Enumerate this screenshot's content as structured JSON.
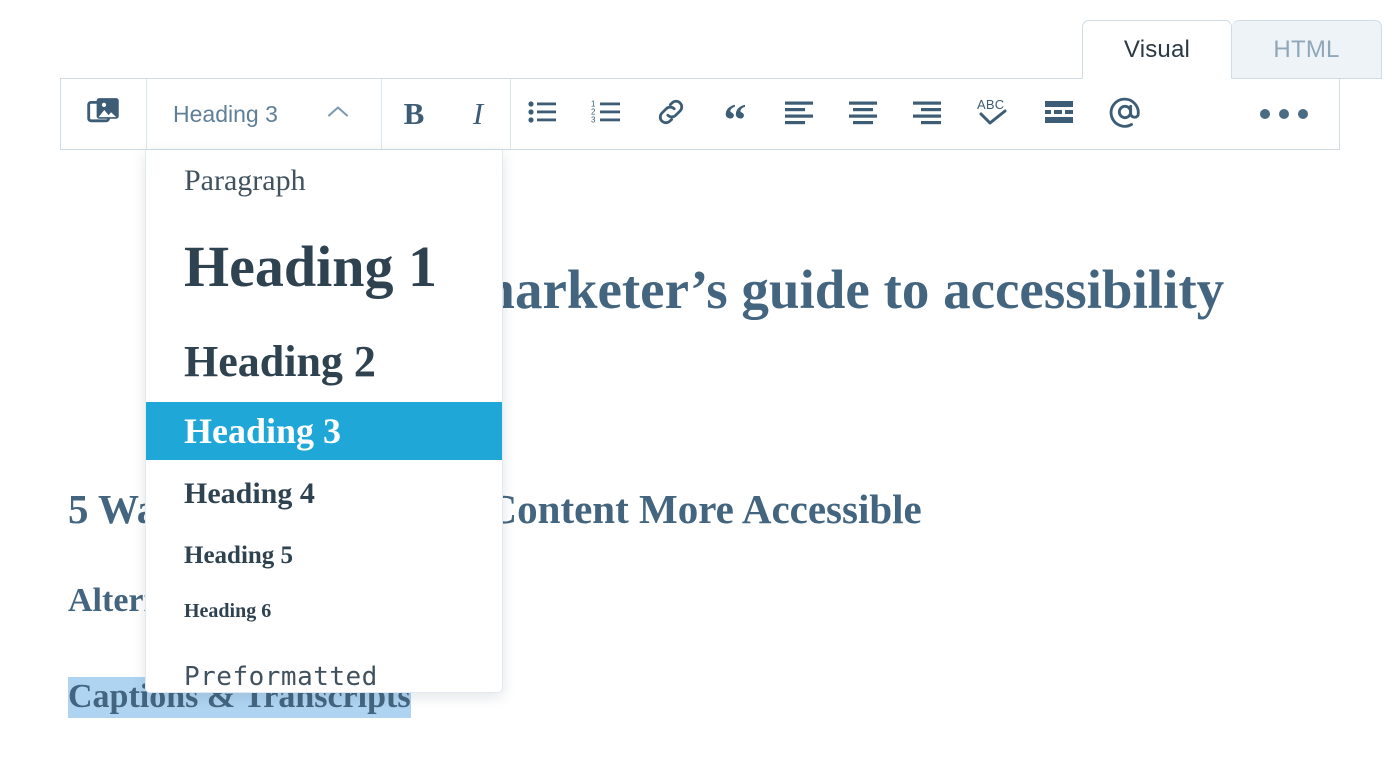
{
  "editor": {
    "tabs": [
      {
        "label": "Visual",
        "active": true,
        "name": "tab-visual"
      },
      {
        "label": "HTML",
        "active": false,
        "name": "tab-html"
      }
    ],
    "toolbar": {
      "media_icon": "media-library-icon",
      "format_select_value": "Heading 3",
      "format_chevron_icon": "chevron-up-icon",
      "buttons": [
        {
          "name": "bold-button",
          "icon": "bold-icon",
          "label": "B"
        },
        {
          "name": "italic-button",
          "icon": "italic-icon",
          "label": "I"
        },
        {
          "name": "bulleted-list-button",
          "icon": "bulleted-list-icon"
        },
        {
          "name": "numbered-list-button",
          "icon": "numbered-list-icon"
        },
        {
          "name": "link-button",
          "icon": "link-icon"
        },
        {
          "name": "blockquote-button",
          "icon": "quote-icon",
          "label": "“"
        },
        {
          "name": "align-left-button",
          "icon": "align-left-icon"
        },
        {
          "name": "align-center-button",
          "icon": "align-center-icon"
        },
        {
          "name": "align-right-button",
          "icon": "align-right-icon"
        },
        {
          "name": "spellcheck-button",
          "icon": "spellcheck-abc-icon",
          "label": "ABC"
        },
        {
          "name": "read-more-button",
          "icon": "insert-read-more-icon"
        },
        {
          "name": "mention-button",
          "icon": "at-mention-icon",
          "label": "@"
        },
        {
          "name": "more-options-button",
          "icon": "ellipsis-icon"
        }
      ]
    },
    "format_dropdown": {
      "open": true,
      "highlight_color": "#1fa7d8",
      "items": [
        {
          "label": "Paragraph",
          "style": "dd-paragraph",
          "selected": false,
          "name": "dropdown-item-paragraph"
        },
        {
          "label": "Heading 1",
          "style": "dd-h1",
          "selected": false,
          "name": "dropdown-item-heading-1"
        },
        {
          "label": "Heading 2",
          "style": "dd-h2",
          "selected": false,
          "name": "dropdown-item-heading-2"
        },
        {
          "label": "Heading 3",
          "style": "dd-h3",
          "selected": true,
          "name": "dropdown-item-heading-3"
        },
        {
          "label": "Heading 4",
          "style": "dd-h4",
          "selected": false,
          "name": "dropdown-item-heading-4"
        },
        {
          "label": "Heading 5",
          "style": "dd-h5",
          "selected": false,
          "name": "dropdown-item-heading-5"
        },
        {
          "label": "Heading 6",
          "style": "dd-h6",
          "selected": false,
          "name": "dropdown-item-heading-6"
        },
        {
          "label": "Preformatted",
          "style": "dd-pre",
          "selected": false,
          "name": "dropdown-item-preformatted"
        }
      ]
    },
    "document": {
      "title": "The content marketer’s guide to accessibility",
      "heading_2": "5 Ways to Make Online Content More Accessible",
      "heading_3_a": "Alternative Text",
      "heading_3_b": "Captions & Transcripts",
      "selection_highlight_color": "#aed4f2",
      "text_color": "#44657f"
    }
  }
}
